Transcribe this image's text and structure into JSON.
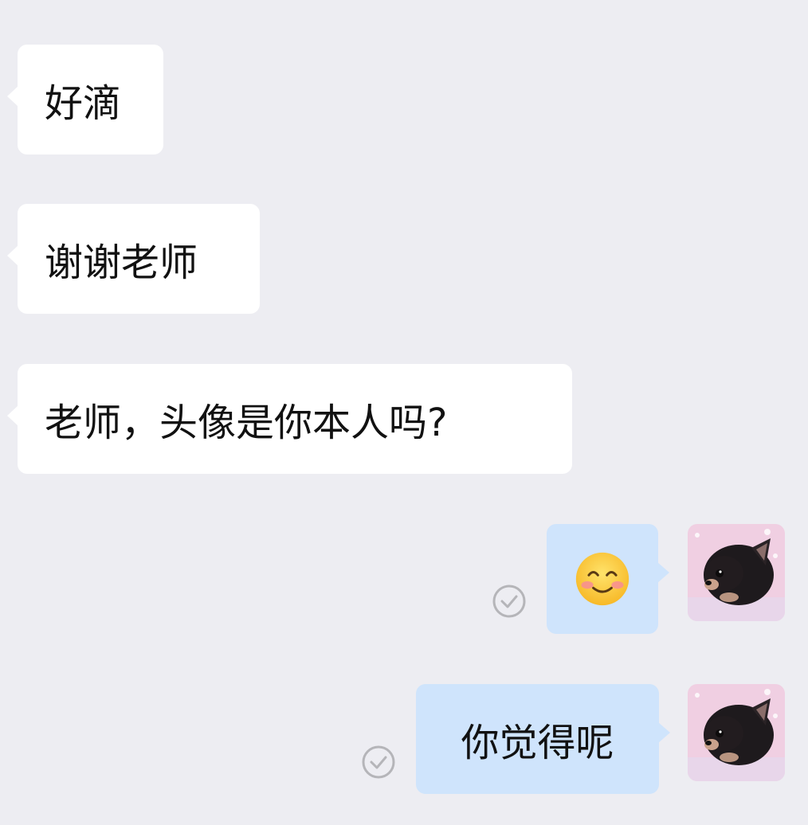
{
  "messages": [
    {
      "id": "m1",
      "direction": "incoming",
      "text": "好滴"
    },
    {
      "id": "m2",
      "direction": "incoming",
      "text": "谢谢老师"
    },
    {
      "id": "m3",
      "direction": "incoming",
      "text": "老师，头像是你本人吗?"
    },
    {
      "id": "m4",
      "direction": "outgoing",
      "type": "emoji",
      "emoji": "smiling-face-with-smiling-eyes",
      "status": "read-check-icon"
    },
    {
      "id": "m5",
      "direction": "outgoing",
      "text": "你觉得呢",
      "status": "read-check-icon"
    }
  ],
  "user_avatar": {
    "icon": "chihuahua-puppy-avatar"
  },
  "colors": {
    "background": "#ededf2",
    "incoming_bubble": "#ffffff",
    "outgoing_bubble": "#cfe4fc",
    "status_check": "#b5b5b9"
  }
}
